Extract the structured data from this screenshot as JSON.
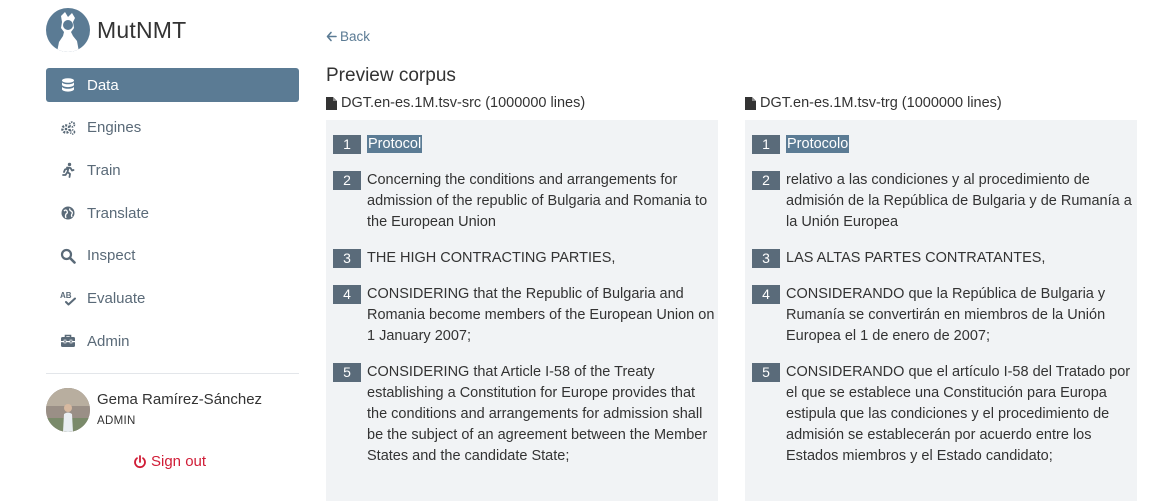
{
  "brand": {
    "name": "MutNMT"
  },
  "nav": {
    "items": [
      {
        "label": "Data",
        "icon": "database-icon",
        "active": true
      },
      {
        "label": "Engines",
        "icon": "cogs-icon",
        "active": false
      },
      {
        "label": "Train",
        "icon": "running-icon",
        "active": false
      },
      {
        "label": "Translate",
        "icon": "globe-icon",
        "active": false
      },
      {
        "label": "Inspect",
        "icon": "search-icon",
        "active": false
      },
      {
        "label": "Evaluate",
        "icon": "spell-check-icon",
        "active": false
      },
      {
        "label": "Admin",
        "icon": "toolbox-icon",
        "active": false
      }
    ]
  },
  "user": {
    "name": "Gema Ramírez-Sánchez",
    "role": "ADMIN"
  },
  "signout": {
    "label": "Sign out"
  },
  "back": {
    "label": "Back"
  },
  "page": {
    "title": "Preview corpus"
  },
  "colors": {
    "accent": "#5b7b94",
    "danger": "#d01c36",
    "panel": "#f1f3f5"
  },
  "source": {
    "file_label": "DGT.en-es.1M.tsv-src (1000000 lines)",
    "lines": [
      {
        "n": "1",
        "text": "Protocol"
      },
      {
        "n": "2",
        "text": "Concerning the conditions and arrangements for admission of the republic of Bulgaria and Romania to the European Union"
      },
      {
        "n": "3",
        "text": "THE HIGH CONTRACTING PARTIES,"
      },
      {
        "n": "4",
        "text": "CONSIDERING that the Republic of Bulgaria and Romania become members of the European Union on 1 January 2007;"
      },
      {
        "n": "5",
        "text": "CONSIDERING that Article I-58 of the Treaty establishing a Constitution for Europe provides that the conditions and arrangements for admission shall be the subject of an agreement between the Member States and the candidate State;"
      }
    ]
  },
  "target": {
    "file_label": "DGT.en-es.1M.tsv-trg (1000000 lines)",
    "lines": [
      {
        "n": "1",
        "text": "Protocolo"
      },
      {
        "n": "2",
        "text": "relativo a las condiciones y al procedimiento de admisión de la República de Bulgaria y de Rumanía a la Unión Europea"
      },
      {
        "n": "3",
        "text": "LAS ALTAS PARTES CONTRATANTES,"
      },
      {
        "n": "4",
        "text": "CONSIDERANDO que la República de Bulgaria y Rumanía se convertirán en miembros de la Unión Europea el 1 de enero de 2007;"
      },
      {
        "n": "5",
        "text": "CONSIDERANDO que el artículo I-58 del Tratado por el que se establece una Constitución para Europa estipula que las condiciones y el procedimiento de admisión se establecerán por acuerdo entre los Estados miembros y el Estado candidato;"
      }
    ]
  }
}
